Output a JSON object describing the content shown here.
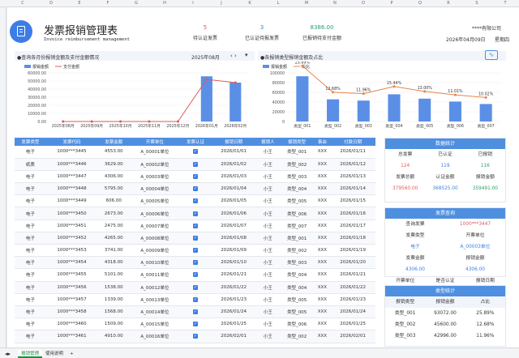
{
  "header": {
    "title": "发票报销管理表",
    "subtitle": "Invoice reimbursement management",
    "stats": [
      {
        "value": "5",
        "label": "待认证发票",
        "color": "#e05a5a"
      },
      {
        "value": "3",
        "label": "已认证待报发票",
        "color": "#3c7de6"
      },
      {
        "value": "8386.00",
        "label": "已报销待支付金额",
        "color": "#29a06a"
      }
    ],
    "company": "****有限公司",
    "date": "2026年04月09日",
    "weekday": "星期四"
  },
  "left_chart_header": {
    "title": "●查询各月份报销金额及支付金额情况",
    "month": "2025年08月",
    "nav": "‹ ›"
  },
  "right_chart_header": {
    "title": "●各报销类型报销金额及占比"
  },
  "column_letters": [
    "C",
    "D",
    "E",
    "F",
    "G",
    "H",
    "I",
    "J",
    "K",
    "L",
    "M",
    "N",
    "O",
    "P",
    "Q",
    "R",
    "S",
    "T"
  ],
  "chart_data": [
    {
      "type": "bar",
      "title": "",
      "legend": [
        "报销金额",
        "支付金额"
      ],
      "categories": [
        "2025年08月",
        "2025年09月",
        "2025年10月",
        "2025年11月",
        "2025年12月",
        "2026年01月",
        "2026年02月"
      ],
      "series": [
        {
          "name": "报销金额",
          "values": [
            0,
            0,
            0,
            0,
            0,
            55800,
            48000
          ]
        },
        {
          "name": "支付金额",
          "values": [
            0,
            0,
            0,
            0,
            0,
            52000,
            48000
          ]
        }
      ],
      "ylim": [
        0,
        60000
      ],
      "yticks": [
        "60000.00",
        "50000.00",
        "40000.00",
        "30000.00",
        "20000.00",
        "10000.00",
        "0.00"
      ]
    },
    {
      "type": "bar",
      "title": "",
      "legend": [
        "报销金额",
        "占比"
      ],
      "categories": [
        "类型_001",
        "类型_002",
        "类型_003",
        "类型_004",
        "类型_005",
        "类型_006",
        "类型_007"
      ],
      "series": [
        {
          "name": "报销金额",
          "values": [
            93072,
            45600,
            42996,
            56000,
            47000,
            41000,
            36000
          ]
        },
        {
          "name": "占比",
          "values": [
            25.89,
            12.68,
            11.96,
            15.44,
            13.0,
            11.01,
            10.02
          ]
        }
      ],
      "labels": [
        "25.89%",
        "12.68%",
        "11.96%",
        "15.44%",
        "13.00%",
        "11.01%",
        "10.02%"
      ],
      "ylim": [
        0,
        100000
      ],
      "yticks": [
        "100000",
        "80000",
        "60000",
        "40000",
        "20000",
        "0"
      ]
    }
  ],
  "table": {
    "headers": [
      "发票类型",
      "发票代码",
      "发票金额",
      "开票单位",
      "发票认证",
      "报销日期",
      "报销人",
      "报销类型",
      "事由",
      "付款日期"
    ],
    "rows": [
      [
        "电子",
        "1000***3445",
        "4553.00",
        "A_00001单位",
        "2026/01/01",
        "小王",
        "类型_001",
        "XXX",
        "2026/01/11"
      ],
      [
        "纸质",
        "1000***3446",
        "3629.00",
        "A_00002单位",
        "2026/01/02",
        "小王",
        "类型_002",
        "XXX",
        "2026/01/12"
      ],
      [
        "电子",
        "1000***3447",
        "4306.00",
        "A_00003单位",
        "2026/01/03",
        "小王",
        "类型_003",
        "XXX",
        "2026/01/13"
      ],
      [
        "电子",
        "1000***3448",
        "5795.00",
        "A_00004单位",
        "2026/01/04",
        "小王",
        "类型_004",
        "XXX",
        "2026/01/14"
      ],
      [
        "电子",
        "1000***3449",
        "606.00",
        "A_00005单位",
        "2026/01/05",
        "小王",
        "类型_005",
        "XXX",
        "2026/01/15"
      ],
      [
        "电子",
        "1000***3450",
        "2673.00",
        "A_00006单位",
        "2026/01/06",
        "小王",
        "类型_006",
        "XXX",
        "2026/01/16"
      ],
      [
        "电子",
        "1000***3451",
        "2475.00",
        "A_00007单位",
        "2026/01/07",
        "小王",
        "类型_007",
        "XXX",
        "2026/01/17"
      ],
      [
        "电子",
        "1000***3452",
        "4265.00",
        "A_00008单位",
        "2026/01/08",
        "小王",
        "类型_001",
        "XXX",
        "2026/01/18"
      ],
      [
        "电子",
        "1000***3453",
        "3741.00",
        "A_00009单位",
        "2026/01/09",
        "小王",
        "类型_002",
        "XXX",
        "2026/01/19"
      ],
      [
        "电子",
        "1000***3454",
        "4318.00",
        "A_00010单位",
        "2026/01/10",
        "小王",
        "类型_003",
        "XXX",
        "2026/01/20"
      ],
      [
        "电子",
        "1000***3455",
        "5101.00",
        "A_00011单位",
        "2026/01/21",
        "小王",
        "类型_004",
        "XXX",
        "2026/01/21"
      ],
      [
        "电子",
        "1000***3456",
        "1538.00",
        "A_00012单位",
        "2026/01/22",
        "小王",
        "类型_004",
        "XXX",
        "2026/01/22"
      ],
      [
        "电子",
        "1000***3457",
        "1339.00",
        "A_00013单位",
        "2026/01/23",
        "小王",
        "类型_005",
        "XXX",
        "2026/01/23"
      ],
      [
        "电子",
        "1000***3458",
        "1568.00",
        "A_00014单位",
        "2026/01/24",
        "小王",
        "类型_005",
        "XXX",
        "2026/01/24"
      ],
      [
        "电子",
        "1000***3460",
        "1509.00",
        "A_00015单位",
        "2026/01/25",
        "小王",
        "类型_006",
        "XXX",
        "2026/01/25"
      ],
      [
        "电子",
        "1000***3461",
        "4910.00",
        "A_00016单位",
        "2026/02/01",
        "小王",
        "类型_002",
        "XXX",
        "2026/02/01"
      ]
    ]
  },
  "data_stats": {
    "title": "数据统计",
    "labels1": [
      "总发票",
      "已认证",
      "已报销"
    ],
    "values1": [
      "124",
      "119",
      "116"
    ],
    "labels2": [
      "发票总额",
      "认证金额",
      "报销金额"
    ],
    "values2": [
      "379560.00",
      "368525.00",
      "359491.00"
    ],
    "colors": [
      "#e05a5a",
      "#3c7de6",
      "#29a06a"
    ]
  },
  "invoice_query": {
    "title": "发票查询",
    "label": "查询发票",
    "value": "1000***3447",
    "rows": [
      [
        "发票类型",
        "开票单位"
      ],
      [
        "电子",
        "A_00003单位"
      ],
      [
        "发票金额",
        "报销金额"
      ],
      [
        "4306.00",
        "4306.00"
      ],
      [
        "开票单位",
        "是否认证",
        "报销日期"
      ],
      [
        "A_00003单位",
        "☑",
        "2026/01/03"
      ]
    ]
  },
  "type_stats": {
    "title": "类型统计",
    "headers": [
      "报销类型",
      "报销金额",
      "占比"
    ],
    "rows": [
      [
        "类型_001",
        "93072.00",
        "25.89%"
      ],
      [
        "类型_002",
        "45600.00",
        "12.68%"
      ],
      [
        "类型_003",
        "42996.00",
        "11.96%"
      ]
    ]
  },
  "tabs": [
    "报销管理",
    "使用说明",
    "+"
  ]
}
